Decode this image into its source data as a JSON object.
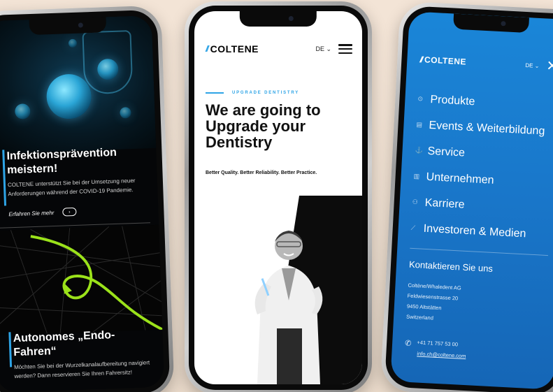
{
  "phone1": {
    "card1": {
      "title": "Infektionsprävention meistern!",
      "body": "COLTENE unterstützt Sie bei der Umsetzung neuer Anforderungen während der COVID-19 Pandemie.",
      "link_label": "Erfahren Sie mehr",
      "arrow": "›"
    },
    "card2": {
      "title": "Autonomes „Endo-Fahren“",
      "body": "Möchten Sie bei der Wurzelkanalaufbereitung navigiert werden? Dann reservieren Sie Ihren Fahrersitz!"
    }
  },
  "phone2": {
    "logo": "COLTENE",
    "logo_mark": "//",
    "lang": "DE ⌄",
    "kicker": "UPGRADE DENTISTRY",
    "headline": "We are going to Upgrade your Dentistry",
    "tagline": "Better Quality. Better Reliability. Better Practice."
  },
  "phone3": {
    "logo": "COLTENE",
    "logo_mark": "//",
    "lang": "DE ⌄",
    "close": "✕",
    "menu": [
      {
        "icon": "⊙",
        "label": "Produkte"
      },
      {
        "icon": "▤",
        "label": "Events & Weiterbildung"
      },
      {
        "icon": "⚓",
        "label": "Service"
      },
      {
        "icon": "▥",
        "label": "Unternehmen"
      },
      {
        "icon": "⚇",
        "label": "Karriere"
      },
      {
        "icon": "⟋",
        "label": "Investoren & Medien"
      }
    ],
    "contact": {
      "heading": "Kontaktieren Sie uns",
      "company": "Coltène/Whaledent AG",
      "street": "Feldwiesenstrasse 20",
      "city": "9450 Altstätten",
      "country": "Switzerland",
      "phone_icon": "✆",
      "phone": "+41 71 757 53 00",
      "email": "info.ch@coltene.com"
    }
  }
}
